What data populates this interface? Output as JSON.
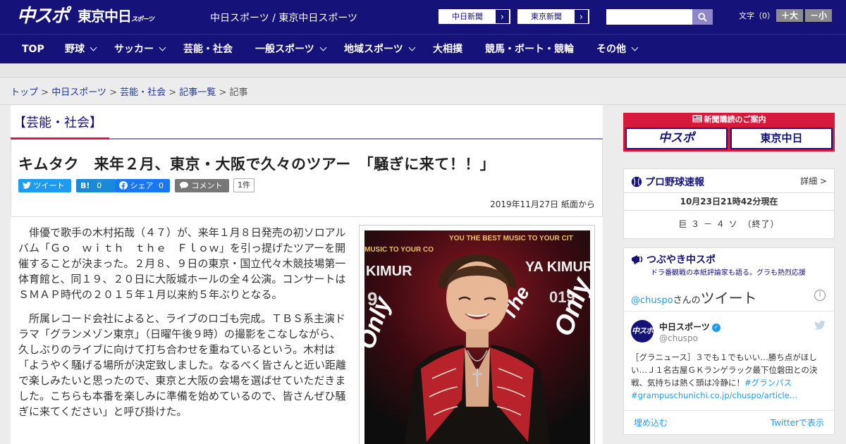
{
  "header": {
    "logo_primary": "中スポ",
    "logo_secondary": "東京中日",
    "logo_secondary_small": "スポーツ",
    "site_title": "中日スポーツ / 東京中日スポーツ",
    "ext_links": [
      "中日新聞",
      "東京新聞"
    ],
    "ext_arrow": "›",
    "search_placeholder": "",
    "fontsize_label": "文字（0）",
    "fontsize_plus": "＋大",
    "fontsize_minus": "－小"
  },
  "nav": {
    "items": [
      {
        "label": "TOP"
      },
      {
        "label": "野球"
      },
      {
        "label": "サッカー"
      },
      {
        "label": "芸能・社会"
      },
      {
        "label": "一般スポーツ"
      },
      {
        "label": "地域スポーツ"
      },
      {
        "label": "大相撲"
      },
      {
        "label": "競馬・ボート・競輪"
      },
      {
        "label": "その他"
      }
    ]
  },
  "breadcrumb": {
    "items": [
      "トップ",
      "中日スポーツ",
      "芸能・社会",
      "記事一覧"
    ],
    "current": "記事",
    "sep": " > "
  },
  "article": {
    "category": "【芸能・社会】",
    "headline": "キムタク　来年２月、東京・大阪で久々のツアー　「騒ぎに来て！！」",
    "share": {
      "tweet": "ツイート",
      "hatena": "B!",
      "hatena_count": "0",
      "facebook": "シェア",
      "facebook_count": "0",
      "comment": "コメント",
      "comment_count": "1件"
    },
    "date": "2019年11月27日 紙面から",
    "paragraphs": [
      "俳優で歌手の木村拓哉（４７）が、来年１月８日発売の初ソロアルバム「Ｇｏ　ｗｉｔｈ　ｔｈｅ　Ｆｌｏｗ」を引っ提げたツアーを開催することが決まった。２月８、９日の東京・国立代々木競技場第一体育館と、同１９、２０日に大阪城ホールの全４公演。コンサートはＳＭＡＰ時代の２０１５年１月以来約５年ぶりとなる。",
      "所属レコード会社によると、ライブのロゴも完成。ＴＢＳ系主演ドラマ「グランメゾン東京」（日曜午後９時）の撮影をこなしながら、久しぶりのライブに向けて打ち合わせを重ねているという。木村は「ようやく騒げる場所が決定致しました。なるべく皆さんと近い距離で楽しみたいと思ったので、東京と大阪の会場を選ばせていただきました。こちらも本番を楽しみに準備を始めているので、皆さんぜひ騒ぎに来てください」と呼び掛けた。"
    ],
    "photo_text": {
      "arc": "MUSIC TO YOUR CO",
      "arc2": "YOU THE BEST MUSIC TO YOUR CIT",
      "name_left": "KIMUR",
      "name_right": "YA KIMURA",
      "year_left": "9",
      "year_right": "019",
      "only_left": "Only",
      "only_mid": "The",
      "only_right": "Only"
    }
  },
  "sidebar": {
    "ad": {
      "top": "新聞購読のご案内",
      "logo1": "中スポ",
      "logo2": "東京中日"
    },
    "scores": {
      "title": "プロ野球速報",
      "detail": "詳細 >",
      "time": "10月23日21時42分現在",
      "line": "巨 ３ － ４ ソ　（終了）"
    },
    "tweets": {
      "title": "つぶやき中スポ",
      "sub": "ドラ番観戦の本紙評論家も語る。グラも熱烈応援",
      "head_handle": "@chuspo",
      "head_san": "さんの",
      "head_tweet": "ツイート",
      "info": "i",
      "account_name": "中日スポーツ",
      "verified": "✓",
      "account_handle": "@chuspo",
      "avatar": "中スポ",
      "text": "［グラニュース］３でも１でもいい…勝ち点がほしい…Ｊ１名古屋ＧＫランゲラック最下位磐田との決戦、気持ちは熱く頭は冷静に！",
      "tags": "#グランパス",
      "link": "#grampuschunichi.co.jp/chuspo/article…",
      "embed": "埋め込む",
      "view": "Twitterで表示"
    }
  }
}
